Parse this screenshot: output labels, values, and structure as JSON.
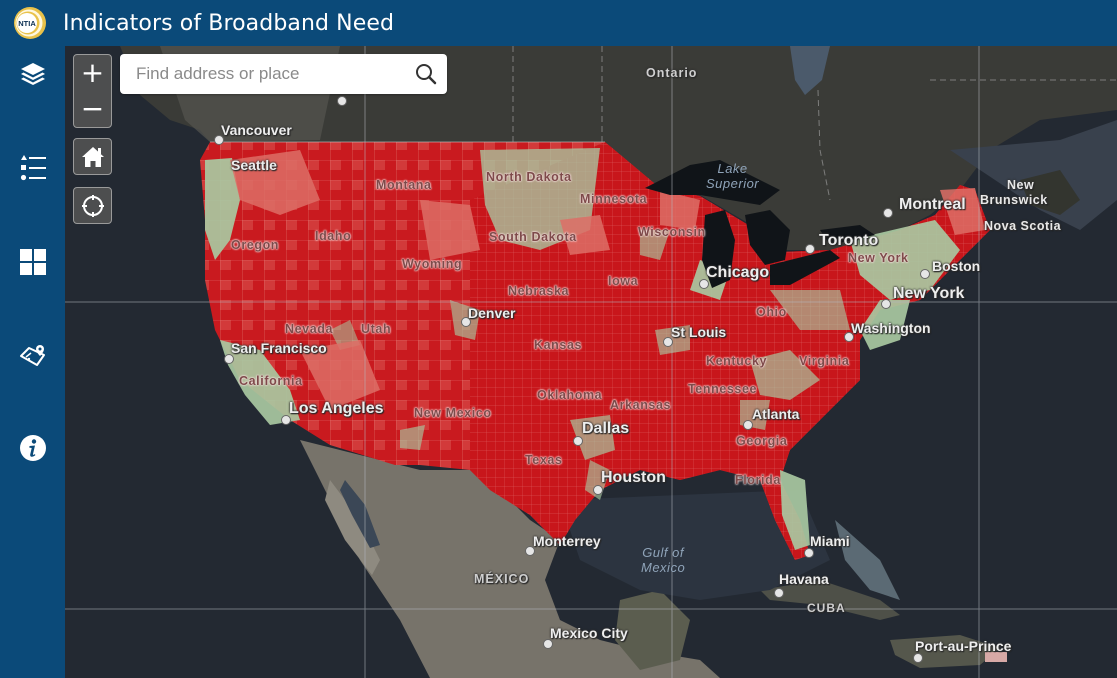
{
  "app": {
    "title": "Indicators of Broadband Need",
    "logo_text": "NTIA"
  },
  "sidebar": {
    "items": [
      {
        "id": "layers",
        "icon": "layers-icon"
      },
      {
        "id": "legend",
        "icon": "legend-list-icon"
      },
      {
        "id": "basemap-gallery",
        "icon": "grid-icon"
      },
      {
        "id": "map-location",
        "icon": "map-pin-icon"
      },
      {
        "id": "about",
        "icon": "info-icon"
      }
    ]
  },
  "map_controls": {
    "zoom_in": "+",
    "zoom_out": "−",
    "home": "home-icon",
    "locate": "locate-icon"
  },
  "search": {
    "placeholder": "Find address or place",
    "value": ""
  },
  "colors": {
    "header": "#0b4a79",
    "high_need": "#c8161b",
    "medium_need": "#df6b62",
    "low_need": "#a7c9a0",
    "ocean": "#242a33"
  },
  "labels": {
    "countries": [
      "Ontario",
      "MÉXICO",
      "CUBA"
    ],
    "water": [
      "Lake Superior",
      "Gulf of Mexico"
    ],
    "states": [
      "Montana",
      "North Dakota",
      "Minnesota",
      "Idaho",
      "Oregon",
      "South Dakota",
      "Wyoming",
      "Wisconsin",
      "Iowa",
      "Nebraska",
      "Nevada",
      "Utah",
      "California",
      "Kansas",
      "Ohio",
      "Kentucky",
      "Virginia",
      "Tennessee",
      "Oklahoma",
      "Arkansas",
      "New Mexico",
      "Texas",
      "Georgia",
      "Florida",
      "New York"
    ],
    "cities": [
      "Vancouver",
      "Seattle",
      "Montreal",
      "Toronto",
      "Chicago",
      "Boston",
      "New York",
      "Denver",
      "San Francisco",
      "St Louis",
      "Washington",
      "Los Angeles",
      "Atlanta",
      "Dallas",
      "Houston",
      "Monterrey",
      "Miami",
      "Havana",
      "Mexico City",
      "Port-au-Prince"
    ],
    "provinces": [
      "New Brunswick",
      "Nova Scotia"
    ]
  }
}
